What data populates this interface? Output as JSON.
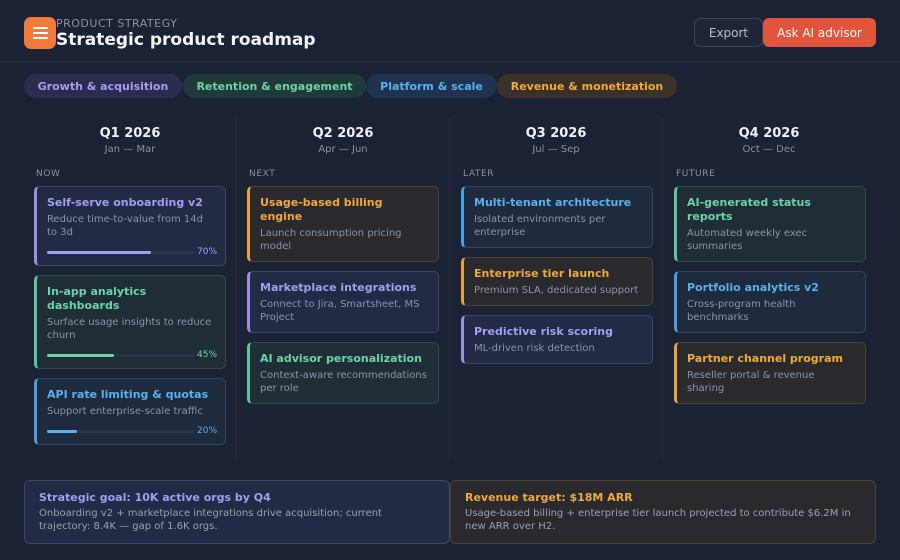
{
  "header": {
    "eyebrow": "PRODUCT STRATEGY",
    "title": "Strategic product roadmap",
    "export_label": "Export",
    "ask_label": "Ask AI advisor"
  },
  "tabs": [
    {
      "label": "Growth & acquisition",
      "color": "#a89cf0"
    },
    {
      "label": "Retention & engagement",
      "color": "#6ed3a8"
    },
    {
      "label": "Platform & scale",
      "color": "#5bb0ee"
    },
    {
      "label": "Revenue & monetization",
      "color": "#f0aa3c"
    }
  ],
  "columns": [
    {
      "quarter": "Q1 2026",
      "range": "Jan — Mar",
      "stage": "NOW",
      "cards": [
        {
          "title_lines": [
            "Self-serve onboarding v2"
          ],
          "desc_lines": [
            "Reduce time-to-value from 14d",
            "to 3d"
          ],
          "progress": 70,
          "progress_label": "70%",
          "theme": "purple"
        },
        {
          "title_lines": [
            "In-app analytics",
            "dashboards"
          ],
          "desc_lines": [
            "Surface usage insights to reduce",
            "churn"
          ],
          "progress": 45,
          "progress_label": "45%",
          "theme": "green"
        },
        {
          "title_lines": [
            "API rate limiting & quotas"
          ],
          "desc_lines": [
            "Support enterprise-scale traffic"
          ],
          "progress": 20,
          "progress_label": "20%",
          "theme": "blue"
        }
      ]
    },
    {
      "quarter": "Q2 2026",
      "range": "Apr — Jun",
      "stage": "NEXT",
      "cards": [
        {
          "title_lines": [
            "Usage-based billing",
            "engine"
          ],
          "desc_lines": [
            "Launch consumption pricing",
            "model"
          ],
          "theme": "orange"
        },
        {
          "title_lines": [
            "Marketplace integrations"
          ],
          "desc_lines": [
            "Connect to Jira, Smartsheet, MS",
            "Project"
          ],
          "theme": "purple"
        },
        {
          "title_lines": [
            "AI advisor personalization"
          ],
          "desc_lines": [
            "Context-aware recommendations",
            "per role"
          ],
          "theme": "green"
        }
      ]
    },
    {
      "quarter": "Q3 2026",
      "range": "Jul — Sep",
      "stage": "LATER",
      "cards": [
        {
          "title_lines": [
            "Multi-tenant architecture"
          ],
          "desc_lines": [
            "Isolated environments per",
            "enterprise"
          ],
          "theme": "blue"
        },
        {
          "title_lines": [
            "Enterprise tier launch"
          ],
          "desc_lines": [
            "Premium SLA, dedicated support"
          ],
          "theme": "orange"
        },
        {
          "title_lines": [
            "Predictive risk scoring"
          ],
          "desc_lines": [
            "ML-driven risk detection"
          ],
          "theme": "purple"
        }
      ]
    },
    {
      "quarter": "Q4 2026",
      "range": "Oct — Dec",
      "stage": "FUTURE",
      "cards": [
        {
          "title_lines": [
            "AI-generated status",
            "reports"
          ],
          "desc_lines": [
            "Automated weekly exec",
            "summaries"
          ],
          "theme": "green"
        },
        {
          "title_lines": [
            "Portfolio analytics v2"
          ],
          "desc_lines": [
            "Cross-program health",
            "benchmarks"
          ],
          "theme": "blue"
        },
        {
          "title_lines": [
            "Partner channel program"
          ],
          "desc_lines": [
            "Reseller portal & revenue",
            "sharing"
          ],
          "theme": "orange"
        }
      ]
    }
  ],
  "footer": [
    {
      "title": "Strategic goal: 10K active orgs by Q4",
      "desc_lines": [
        "Onboarding v2 + marketplace integrations drive acquisition; current",
        "trajectory: 8.4K — gap of 1.6K orgs."
      ],
      "theme": "purple"
    },
    {
      "title": "Revenue target: $18M ARR",
      "desc_lines": [
        "Usage-based billing + enterprise tier launch projected to contribute $6.2M in",
        "new ARR over H2."
      ],
      "theme": "orange"
    }
  ],
  "theme_colors": {
    "purple": "#a89cf0",
    "green": "#6ed3a8",
    "blue": "#5bb0ee",
    "orange": "#f0aa3c",
    "accent": "#e2553d"
  }
}
